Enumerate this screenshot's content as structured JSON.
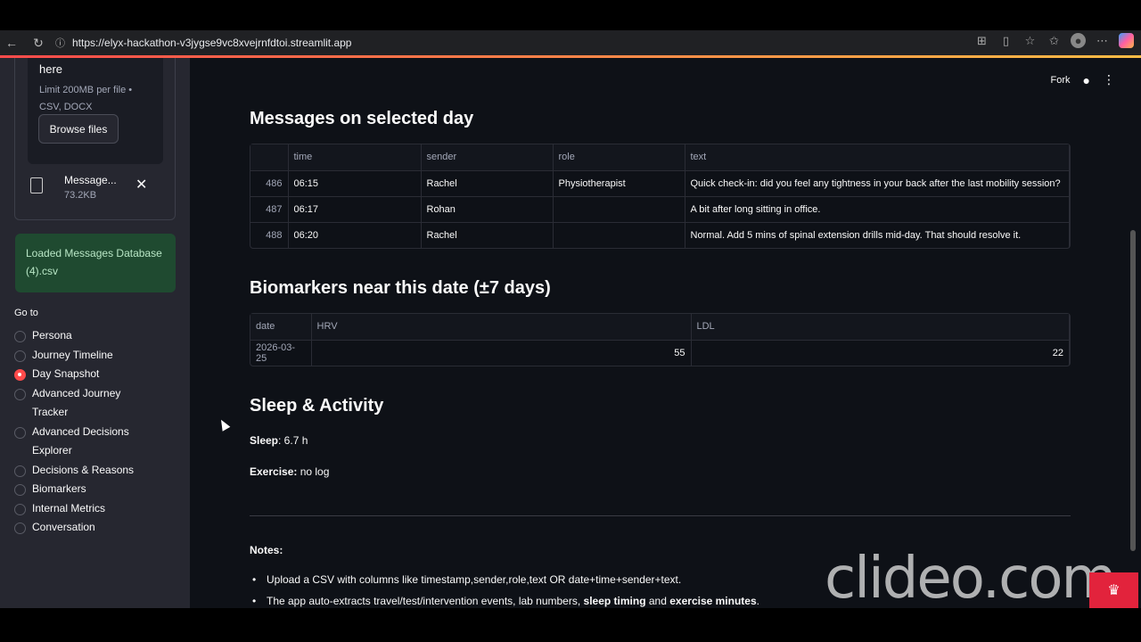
{
  "browser": {
    "url": "https://elyx-hackathon-v3jygse9vc8xvejrnfdtoi.streamlit.app"
  },
  "sidebar": {
    "uploader": {
      "drop_text": "here",
      "limit_text": "Limit 200MB per file • CSV, DOCX",
      "browse_label": "Browse files",
      "file_name": "Message...",
      "file_size": "73.2KB"
    },
    "success_message": "Loaded Messages Database (4).csv",
    "goto_label": "Go to",
    "nav": [
      {
        "label": "Persona",
        "selected": false
      },
      {
        "label": "Journey Timeline",
        "selected": false
      },
      {
        "label": "Day Snapshot",
        "selected": true
      },
      {
        "label": "Advanced Journey Tracker",
        "selected": false
      },
      {
        "label": "Advanced Decisions Explorer",
        "selected": false
      },
      {
        "label": "Decisions & Reasons",
        "selected": false
      },
      {
        "label": "Biomarkers",
        "selected": false
      },
      {
        "label": "Internal Metrics",
        "selected": false
      },
      {
        "label": "Conversation",
        "selected": false
      }
    ]
  },
  "header": {
    "fork_label": "Fork"
  },
  "messages_section": {
    "title": "Messages on selected day",
    "columns": [
      "",
      "time",
      "sender",
      "role",
      "text"
    ],
    "rows": [
      {
        "idx": "486",
        "time": "06:15",
        "sender": "Rachel",
        "role": "Physiotherapist",
        "text": "Quick check-in: did you feel any tightness in your back after the last mobility session?"
      },
      {
        "idx": "487",
        "time": "06:17",
        "sender": "Rohan",
        "role": "",
        "text": "A bit after long sitting in office."
      },
      {
        "idx": "488",
        "time": "06:20",
        "sender": "Rachel",
        "role": "",
        "text": "Normal. Add 5 mins of spinal extension drills mid-day. That should resolve it."
      }
    ]
  },
  "biomarkers_section": {
    "title": "Biomarkers near this date (±7 days)",
    "columns": [
      "date",
      "HRV",
      "LDL"
    ],
    "rows": [
      {
        "date": "2026-03-25",
        "hrv": "55",
        "ldl": "22"
      }
    ]
  },
  "sleep_section": {
    "title": "Sleep & Activity",
    "sleep_label": "Sleep",
    "sleep_value": ": 6.7 h",
    "exercise_label": "Exercise:",
    "exercise_value": " no log"
  },
  "notes": {
    "title": "Notes:",
    "bullet1": "Upload a CSV with columns like timestamp,sender,role,text OR date+time+sender+text.",
    "bullet2_a": "The app auto-extracts travel/test/intervention events, lab numbers, ",
    "bullet2_b": "sleep timing",
    "bullet2_c": " and ",
    "bullet2_d": "exercise minutes",
    "bullet2_e": "."
  },
  "watermark": {
    "text": "clideo.com"
  }
}
